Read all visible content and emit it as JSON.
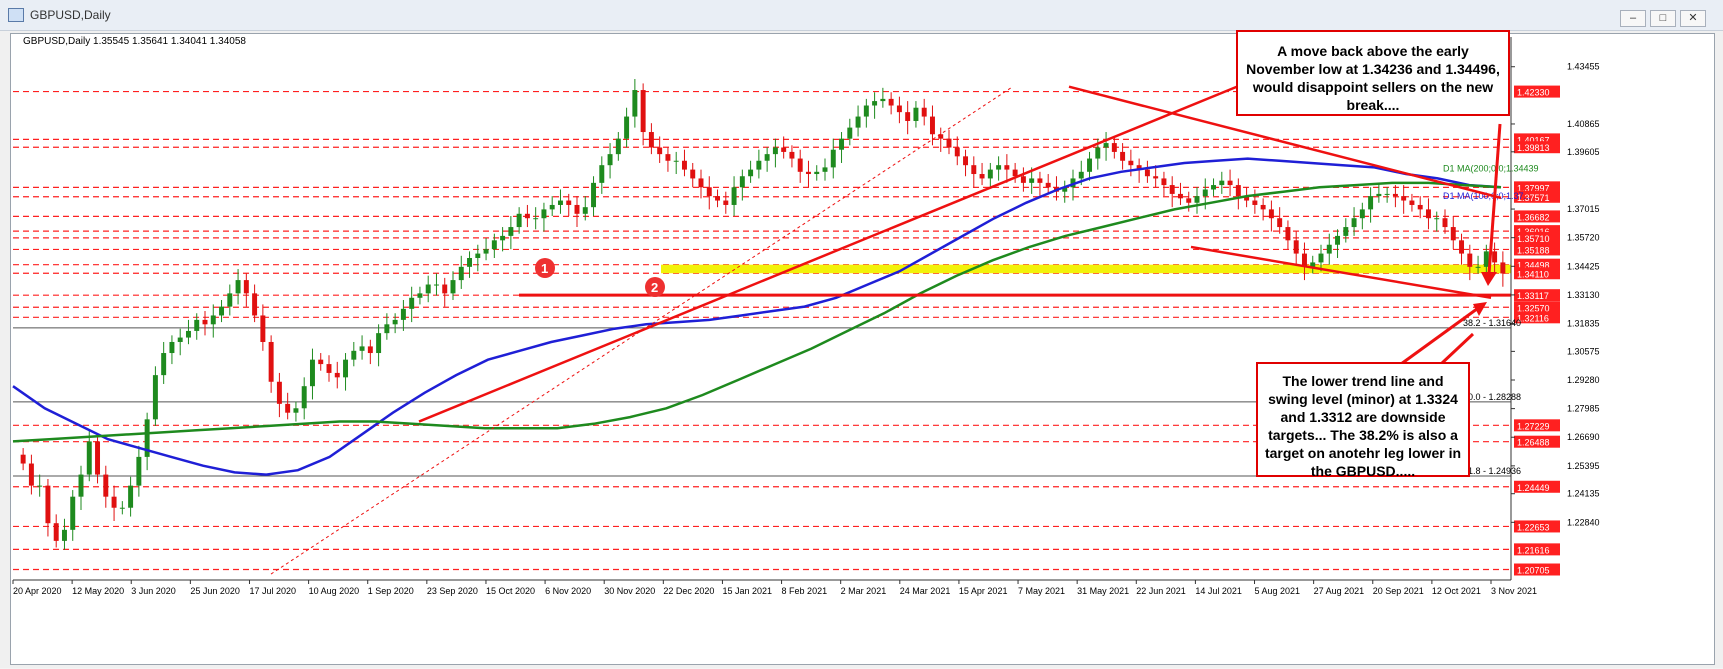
{
  "window": {
    "title": "GBPUSD,Daily",
    "buttons": [
      "–",
      "□",
      "✕"
    ]
  },
  "chart_header": "GBPUSD,Daily  1.35545 1.35641 1.34041 1.34058",
  "chart_data": {
    "type": "candlestick",
    "title": "GBPUSD,Daily",
    "ohlc_last": {
      "open": 1.35545,
      "high": 1.35641,
      "low": 1.34041,
      "close": 1.34058
    },
    "x_tick_labels": [
      "20 Apr 2020",
      "12 May 2020",
      "3 Jun 2020",
      "25 Jun 2020",
      "17 Jul 2020",
      "10 Aug 2020",
      "1 Sep 2020",
      "23 Sep 2020",
      "15 Oct 2020",
      "6 Nov 2020",
      "30 Nov 2020",
      "22 Dec 2020",
      "15 Jan 2021",
      "8 Feb 2021",
      "2 Mar 2021",
      "24 Mar 2021",
      "15 Apr 2021",
      "7 May 2021",
      "31 May 2021",
      "22 Jun 2021",
      "14 Jul 2021",
      "5 Aug 2021",
      "27 Aug 2021",
      "20 Sep 2021",
      "12 Oct 2021",
      "3 Nov 2021"
    ],
    "y_range": [
      1.2023,
      1.448
    ],
    "y_tick_labels": [
      1.43455,
      1.40865,
      1.39605,
      1.37015,
      1.3572,
      1.34425,
      1.3313,
      1.31835,
      1.30575,
      1.2928,
      1.27985,
      1.2669,
      1.25395,
      1.24135,
      1.2284
    ],
    "close_series": [
      1.255,
      1.245,
      1.245,
      1.228,
      1.22,
      1.225,
      1.24,
      1.25,
      1.265,
      1.25,
      1.24,
      1.235,
      1.235,
      1.245,
      1.258,
      1.275,
      1.295,
      1.305,
      1.31,
      1.312,
      1.315,
      1.32,
      1.318,
      1.322,
      1.326,
      1.332,
      1.338,
      1.332,
      1.322,
      1.31,
      1.292,
      1.282,
      1.278,
      1.28,
      1.29,
      1.302,
      1.3,
      1.296,
      1.294,
      1.302,
      1.306,
      1.308,
      1.305,
      1.314,
      1.318,
      1.32,
      1.325,
      1.33,
      1.332,
      1.336,
      1.336,
      1.332,
      1.338,
      1.344,
      1.348,
      1.35,
      1.352,
      1.356,
      1.358,
      1.362,
      1.368,
      1.366,
      1.366,
      1.37,
      1.372,
      1.374,
      1.372,
      1.368,
      1.371,
      1.382,
      1.39,
      1.395,
      1.402,
      1.412,
      1.424,
      1.405,
      1.398,
      1.395,
      1.392,
      1.392,
      1.388,
      1.384,
      1.38,
      1.376,
      1.374,
      1.372,
      1.38,
      1.385,
      1.388,
      1.392,
      1.395,
      1.398,
      1.396,
      1.393,
      1.387,
      1.386,
      1.387,
      1.389,
      1.397,
      1.402,
      1.407,
      1.412,
      1.417,
      1.419,
      1.42,
      1.417,
      1.414,
      1.41,
      1.416,
      1.412,
      1.404,
      1.402,
      1.398,
      1.394,
      1.39,
      1.386,
      1.384,
      1.388,
      1.39,
      1.388,
      1.385,
      1.382,
      1.384,
      1.382,
      1.38,
      1.378,
      1.38,
      1.384,
      1.387,
      1.393,
      1.398,
      1.4,
      1.396,
      1.392,
      1.39,
      1.388,
      1.385,
      1.384,
      1.381,
      1.377,
      1.375,
      1.373,
      1.376,
      1.379,
      1.381,
      1.383,
      1.381,
      1.376,
      1.374,
      1.372,
      1.37,
      1.366,
      1.362,
      1.356,
      1.35,
      1.344,
      1.346,
      1.35,
      1.354,
      1.358,
      1.362,
      1.366,
      1.37,
      1.376,
      1.377,
      1.377,
      1.376,
      1.374,
      1.372,
      1.37,
      1.366,
      1.366,
      1.362,
      1.356,
      1.35,
      1.344,
      1.344,
      1.351,
      1.346,
      1.341
    ],
    "ma100_series": [
      1.29,
      1.28,
      1.273,
      1.266,
      1.262,
      1.258,
      1.254,
      1.251,
      1.25,
      1.252,
      1.258,
      1.268,
      1.278,
      1.287,
      1.295,
      1.302,
      1.306,
      1.31,
      1.313,
      1.316,
      1.318,
      1.319,
      1.32,
      1.322,
      1.324,
      1.326,
      1.33,
      1.336,
      1.342,
      1.35,
      1.358,
      1.366,
      1.373,
      1.379,
      1.384,
      1.387,
      1.389,
      1.391,
      1.392,
      1.393,
      1.392,
      1.391,
      1.39,
      1.389,
      1.386,
      1.384,
      1.381,
      1.38
    ],
    "ma200_series": [
      1.265,
      1.266,
      1.267,
      1.268,
      1.269,
      1.27,
      1.271,
      1.272,
      1.273,
      1.274,
      1.274,
      1.273,
      1.272,
      1.271,
      1.271,
      1.271,
      1.273,
      1.276,
      1.28,
      1.286,
      1.293,
      1.3,
      1.307,
      1.315,
      1.323,
      1.332,
      1.34,
      1.347,
      1.353,
      1.358,
      1.362,
      1.366,
      1.37,
      1.373,
      1.376,
      1.378,
      1.38,
      1.381,
      1.382,
      1.382,
      1.381,
      1.38
    ],
    "ma_labels": [
      "D1 MA(200;0;0;1.34439",
      "D1 MA(100;0;0;1.37..."
    ],
    "level_lines": [
      {
        "label": "1.42330",
        "value": 1.4233
      },
      {
        "label": "1.40167",
        "value": 1.40167
      },
      {
        "label": "1.39813",
        "value": 1.39813
      },
      {
        "label": "1.37997",
        "value": 1.37997
      },
      {
        "label": "1.37571",
        "value": 1.37571
      },
      {
        "label": "1.36682",
        "value": 1.36682
      },
      {
        "label": "1.36016",
        "value": 1.36016
      },
      {
        "label": "1.35710",
        "value": 1.3571
      },
      {
        "label": "1.35188",
        "value": 1.35188
      },
      {
        "label": "1.34498",
        "value": 1.34498
      },
      {
        "label": "1.34110",
        "value": 1.3411
      },
      {
        "label": "1.33117",
        "value": 1.33117
      },
      {
        "label": "1.32570",
        "value": 1.3257
      },
      {
        "label": "1.32116",
        "value": 1.32116
      },
      {
        "label": "1.27229",
        "value": 1.27229
      },
      {
        "label": "1.26488",
        "value": 1.26488
      },
      {
        "label": "1.24449",
        "value": 1.24449
      },
      {
        "label": "1.22653",
        "value": 1.22653
      },
      {
        "label": "1.21616",
        "value": 1.21616
      },
      {
        "label": "1.20705",
        "value": 1.20705
      }
    ],
    "fib_lines": [
      {
        "label": "38.2 - 1.31640",
        "value": 1.3164
      },
      {
        "label": "50.0 - 1.28288",
        "value": 1.28288
      },
      {
        "label": "61.8 - 1.24936",
        "value": 1.24936
      }
    ],
    "support_zone": {
      "from": 1.3411,
      "to": 1.34498
    },
    "markers": [
      "1",
      "2"
    ],
    "colors": {
      "up_candle": "#1e8a1e",
      "down_candle": "#e01010",
      "ma100": "#1f1fd6",
      "ma200": "#1e8a1e",
      "level": "#ff2020",
      "zone": "#f2f20a",
      "callout_border": "#e00000"
    }
  },
  "callouts": {
    "top": "A move back above the early November low at 1.34236 and 1.34496, would disappoint sellers on the new break....",
    "bottom": "The lower trend line and swing level (minor) at 1.3324 and 1.3312 are downside targets... The 38.2% is also a target on anotehr leg lower in the GBPUSD....."
  }
}
